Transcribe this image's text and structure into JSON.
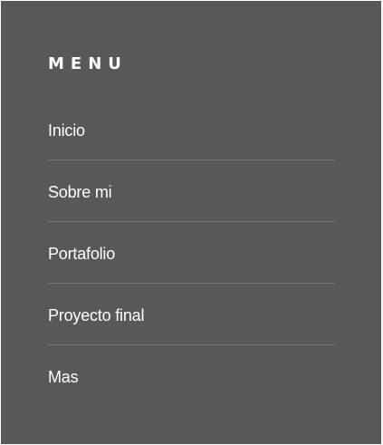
{
  "menu": {
    "heading": "MENU",
    "items": [
      {
        "label": "Inicio"
      },
      {
        "label": "Sobre mi"
      },
      {
        "label": "Portafolio"
      },
      {
        "label": "Proyecto final"
      },
      {
        "label": "Mas"
      }
    ]
  },
  "colors": {
    "panel_background": "#585858",
    "text": "#ffffff",
    "divider": "#767676"
  }
}
